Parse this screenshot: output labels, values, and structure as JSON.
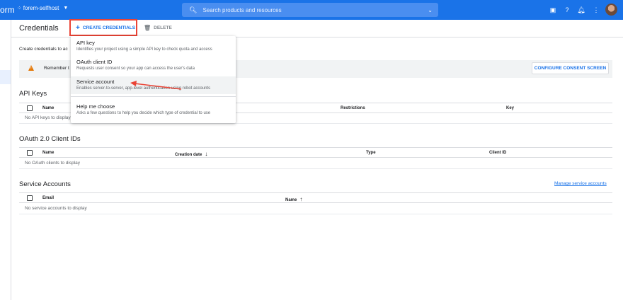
{
  "topbar": {
    "brand": "orm",
    "project": "forem-selfhost",
    "search_placeholder": "Search products and resources"
  },
  "header": {
    "title": "Credentials",
    "create_label": "CREATE CREDENTIALS",
    "delete_label": "DELETE"
  },
  "intro": "Create credentials to ac",
  "banner": {
    "text": "Remember t",
    "button": "CONFIGURE CONSENT SCREEN"
  },
  "menu": {
    "items": [
      {
        "title": "API key",
        "desc": "Identifies your project using a simple API key to check quota and access"
      },
      {
        "title": "OAuth client ID",
        "desc": "Requests user consent so your app can access the user's data"
      },
      {
        "title": "Service account",
        "desc": "Enables server-to-server, app-level authentication using robot accounts"
      },
      {
        "title": "Help me choose",
        "desc": "Asks a few questions to help you decide which type of credential to use"
      }
    ]
  },
  "api_keys": {
    "title": "API Keys",
    "columns": [
      "Name",
      "Restrictions",
      "Key"
    ],
    "empty": "No API keys to display"
  },
  "oauth": {
    "title": "OAuth 2.0 Client IDs",
    "columns": [
      "Name",
      "Creation date",
      "Type",
      "Client ID"
    ],
    "empty": "No OAuth clients to display"
  },
  "service_accounts": {
    "title": "Service Accounts",
    "manage_link": "Manage service accounts",
    "columns": [
      "Email",
      "Name"
    ],
    "empty": "No service accounts to display"
  },
  "colors": {
    "primary": "#1a73e8",
    "highlight_border": "#ea4335",
    "warning": "#e37400"
  }
}
